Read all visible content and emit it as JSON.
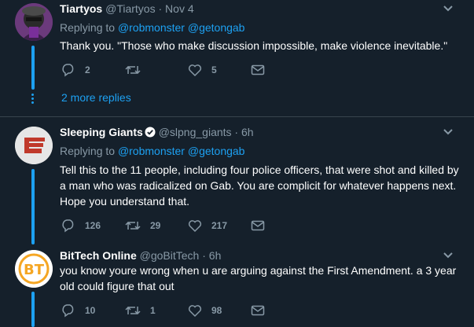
{
  "tweets": [
    {
      "name": "Tiartyos",
      "handle": "@Tiartyos",
      "time": "Nov 4",
      "replying_label": "Replying to",
      "mentions": [
        "@robmonster",
        "@getongab"
      ],
      "text": "Thank you. \"Those who make discussion impossible, make violence inevitable.\"",
      "replies": "2",
      "retweets": "",
      "likes": "5",
      "avatar": "hooded-figure-avatar"
    },
    {
      "name": "Sleeping Giants",
      "handle": "@slpng_giants",
      "time": "6h",
      "verified": true,
      "replying_label": "Replying to",
      "mentions": [
        "@robmonster",
        "@getongab"
      ],
      "text": "Tell this to the 11 people, including four police officers, that were shot and killed by a man who was radicalized on Gab. You are complicit for whatever happens next. Hope you understand that.",
      "replies": "126",
      "retweets": "29",
      "likes": "217",
      "avatar": "sleeping-giants-logo"
    },
    {
      "name": "BitTech Online",
      "handle": "@goBitTech",
      "time": "6h",
      "text": "you know youre wrong when u are arguing against the First Amendment. a 3 year old could figure that out",
      "replies": "10",
      "retweets": "1",
      "likes": "98",
      "avatar": "bitcoin-bt-logo"
    }
  ],
  "more_replies": "2 more replies",
  "dot_separator": "·",
  "colors": {
    "background": "#15202b",
    "accent": "#1da1f2",
    "muted": "#8899a6",
    "divider": "#38444d"
  }
}
